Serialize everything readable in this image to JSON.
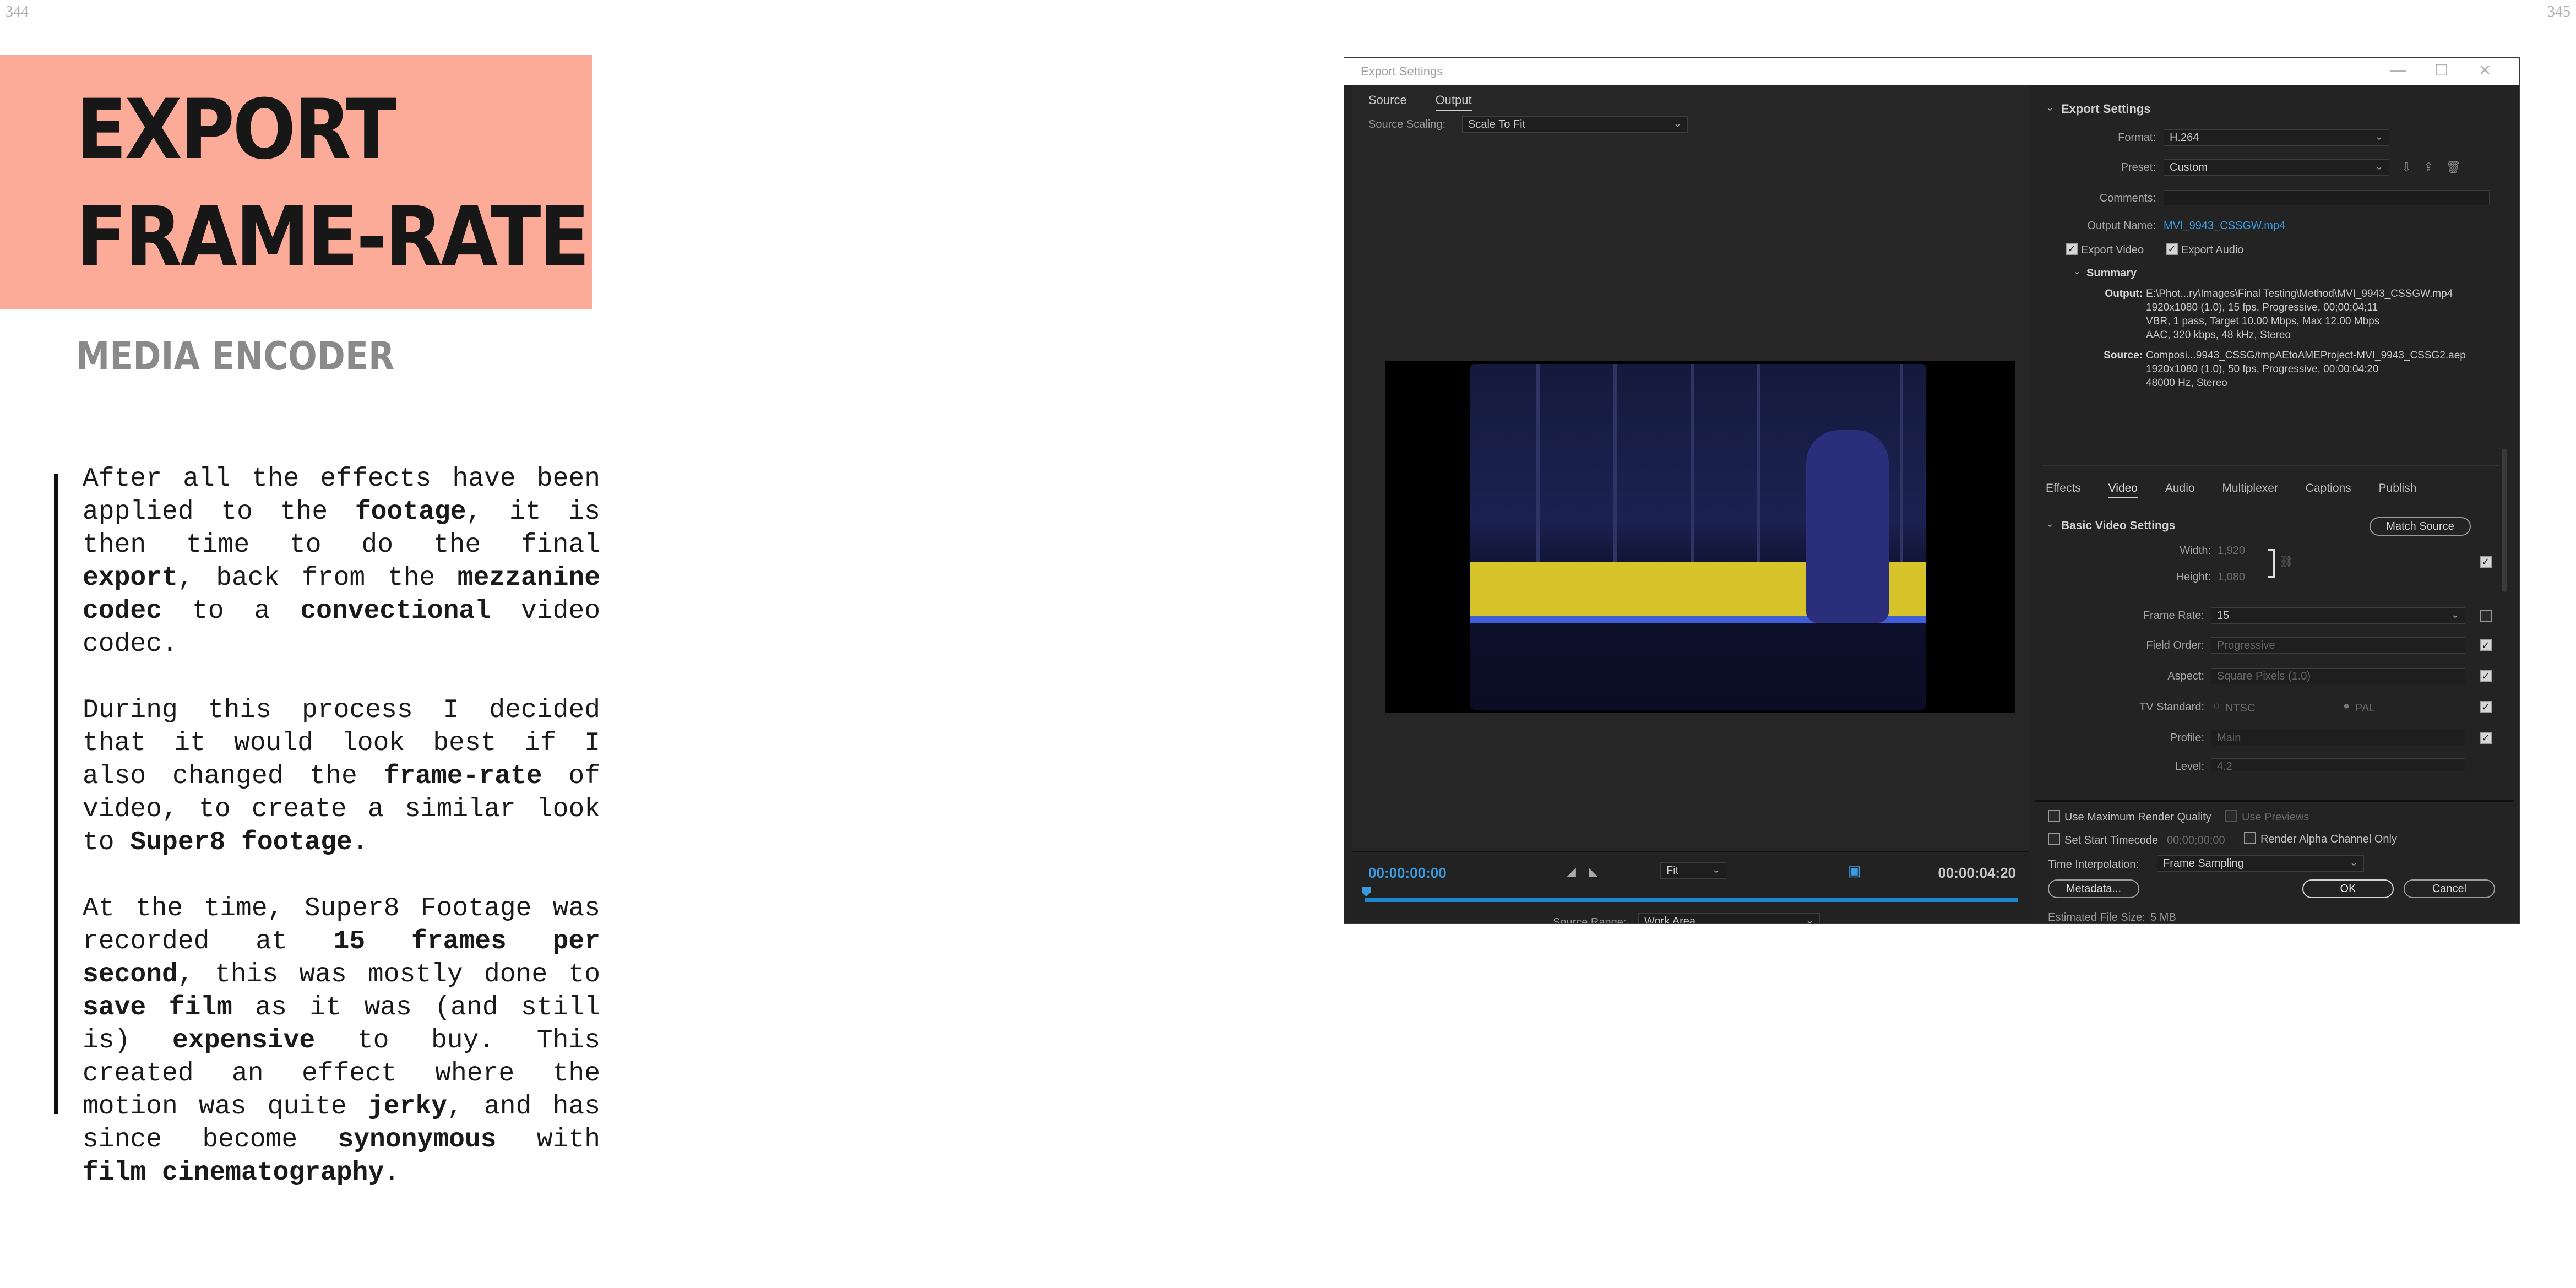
{
  "page_numbers": {
    "left": "344",
    "right": "345"
  },
  "heading": {
    "line1": "EXPORT",
    "line2": "FRAME-RATE"
  },
  "subheading": "MEDIA ENCODER",
  "paragraphs": [
    [
      {
        "t": "After all the effects have been applied to the ",
        "b": false
      },
      {
        "t": "footage",
        "b": true
      },
      {
        "t": ", it is then time to do the final ",
        "b": false
      },
      {
        "t": "export",
        "b": true
      },
      {
        "t": ", back from the ",
        "b": false
      },
      {
        "t": "mezzanine codec",
        "b": true
      },
      {
        "t": " to a ",
        "b": false
      },
      {
        "t": "convectional",
        "b": true
      },
      {
        "t": " video codec.",
        "b": false
      }
    ],
    [
      {
        "t": "During this process I decided that it would look best if I also changed the ",
        "b": false
      },
      {
        "t": "frame-rate",
        "b": true
      },
      {
        "t": " of video, to create a similar look to ",
        "b": false
      },
      {
        "t": "Super8 footage",
        "b": true
      },
      {
        "t": ".",
        "b": false
      }
    ],
    [
      {
        "t": "At the time, Super8 Footage was recorded at ",
        "b": false
      },
      {
        "t": "15 frames per second",
        "b": true
      },
      {
        "t": ", this was mostly done to ",
        "b": false
      },
      {
        "t": "save film",
        "b": true
      },
      {
        "t": " as it was (and still is) ",
        "b": false
      },
      {
        "t": "expensive",
        "b": true
      },
      {
        "t": " to buy. This created an effect where the motion was quite ",
        "b": false
      },
      {
        "t": "jerky",
        "b": true
      },
      {
        "t": ", and has since become ",
        "b": false
      },
      {
        "t": "synonymous",
        "b": true
      },
      {
        "t": " with ",
        "b": false
      },
      {
        "t": "film cinematography",
        "b": true
      },
      {
        "t": ".",
        "b": false
      }
    ]
  ],
  "dialog": {
    "title": "Export Settings",
    "window_controls": {
      "minimize": "—",
      "maximize": "☐",
      "close": "✕"
    },
    "source_tabs": [
      "Source",
      "Output"
    ],
    "source_scaling": {
      "label": "Source Scaling:",
      "value": "Scale To Fit"
    },
    "timeline": {
      "current": "00:00:00:00",
      "duration": "00:00:04:20",
      "zoom": "Fit",
      "source_range_label": "Source Range:",
      "source_range_value": "Work Area"
    },
    "export_settings": {
      "section_title": "Export Settings",
      "format_label": "Format:",
      "format_value": "H.264",
      "preset_label": "Preset:",
      "preset_value": "Custom",
      "comments_label": "Comments:",
      "output_name_label": "Output Name:",
      "output_name_value": "MVI_9943_CSSGW.mp4",
      "export_video": "Export Video",
      "export_audio": "Export Audio",
      "summary_title": "Summary",
      "output_label": "Output:",
      "output_lines": [
        "E:\\Phot...ry\\Images\\Final Testing\\Method\\MVI_9943_CSSGW.mp4",
        "1920x1080 (1.0), 15 fps, Progressive, 00;00;04;11",
        "VBR, 1 pass, Target 10.00 Mbps, Max 12.00 Mbps",
        "AAC, 320 kbps, 48 kHz, Stereo"
      ],
      "source_label": "Source:",
      "source_lines": [
        "Composi...9943_CSSG/tmpAEtoAMEProject-MVI_9943_CSSG2.aep",
        "1920x1080 (1.0), 50 fps, Progressive, 00:00:04:20",
        "48000 Hz, Stereo"
      ]
    },
    "panel_tabs": [
      "Effects",
      "Video",
      "Audio",
      "Multiplexer",
      "Captions",
      "Publish"
    ],
    "video": {
      "section_title": "Basic Video Settings",
      "match_source": "Match Source",
      "width_label": "Width:",
      "width_value": "1,920",
      "height_label": "Height:",
      "height_value": "1,080",
      "frame_rate_label": "Frame Rate:",
      "frame_rate_value": "15",
      "field_order_label": "Field Order:",
      "field_order_value": "Progressive",
      "aspect_label": "Aspect:",
      "aspect_value": "Square Pixels (1.0)",
      "tv_standard_label": "TV Standard:",
      "ntsc": "NTSC",
      "pal": "PAL",
      "profile_label": "Profile:",
      "profile_value": "Main",
      "level_label": "Level:",
      "level_value": "4.2"
    },
    "options": {
      "max_render": "Use Maximum Render Quality",
      "use_previews": "Use Previews",
      "set_start_tc": "Set Start Timecode",
      "start_tc_value": "00;00;00;00",
      "alpha_only": "Render Alpha Channel Only",
      "time_interp_label": "Time Interpolation:",
      "time_interp_value": "Frame Sampling",
      "est_size_label": "Estimated File Size:",
      "est_size_value": "5 MB"
    },
    "buttons": {
      "metadata": "Metadata...",
      "ok": "OK",
      "cancel": "Cancel"
    }
  }
}
